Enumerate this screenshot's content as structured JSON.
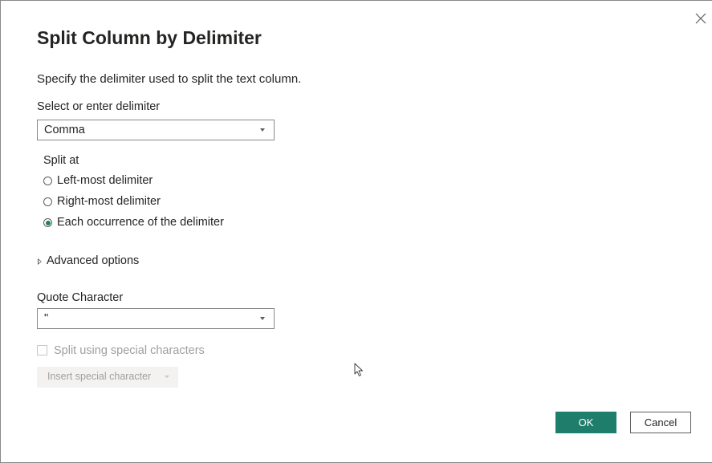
{
  "dialog": {
    "title": "Split Column by Delimiter",
    "description": "Specify the delimiter used to split the text column.",
    "close_icon": "close-icon"
  },
  "delimiter": {
    "label": "Select or enter delimiter",
    "value": "Comma",
    "caret_icon": "chevron-down-icon"
  },
  "split_at": {
    "label": "Split at",
    "options": [
      {
        "label": "Left-most delimiter",
        "checked": false
      },
      {
        "label": "Right-most delimiter",
        "checked": false
      },
      {
        "label": "Each occurrence of the delimiter",
        "checked": true
      }
    ]
  },
  "advanced": {
    "label": "Advanced options",
    "icon": "triangle-right-icon"
  },
  "quote": {
    "label": "Quote Character",
    "value": "\"",
    "caret_icon": "chevron-down-icon"
  },
  "special": {
    "checkbox_label": "Split using special characters",
    "checked": false,
    "disabled": true,
    "insert_button_label": "Insert special character"
  },
  "buttons": {
    "ok": "OK",
    "cancel": "Cancel"
  },
  "colors": {
    "accent": "#1f7d6c",
    "text": "#252423",
    "disabled_text": "#a19f9d",
    "border": "#8a8886"
  }
}
